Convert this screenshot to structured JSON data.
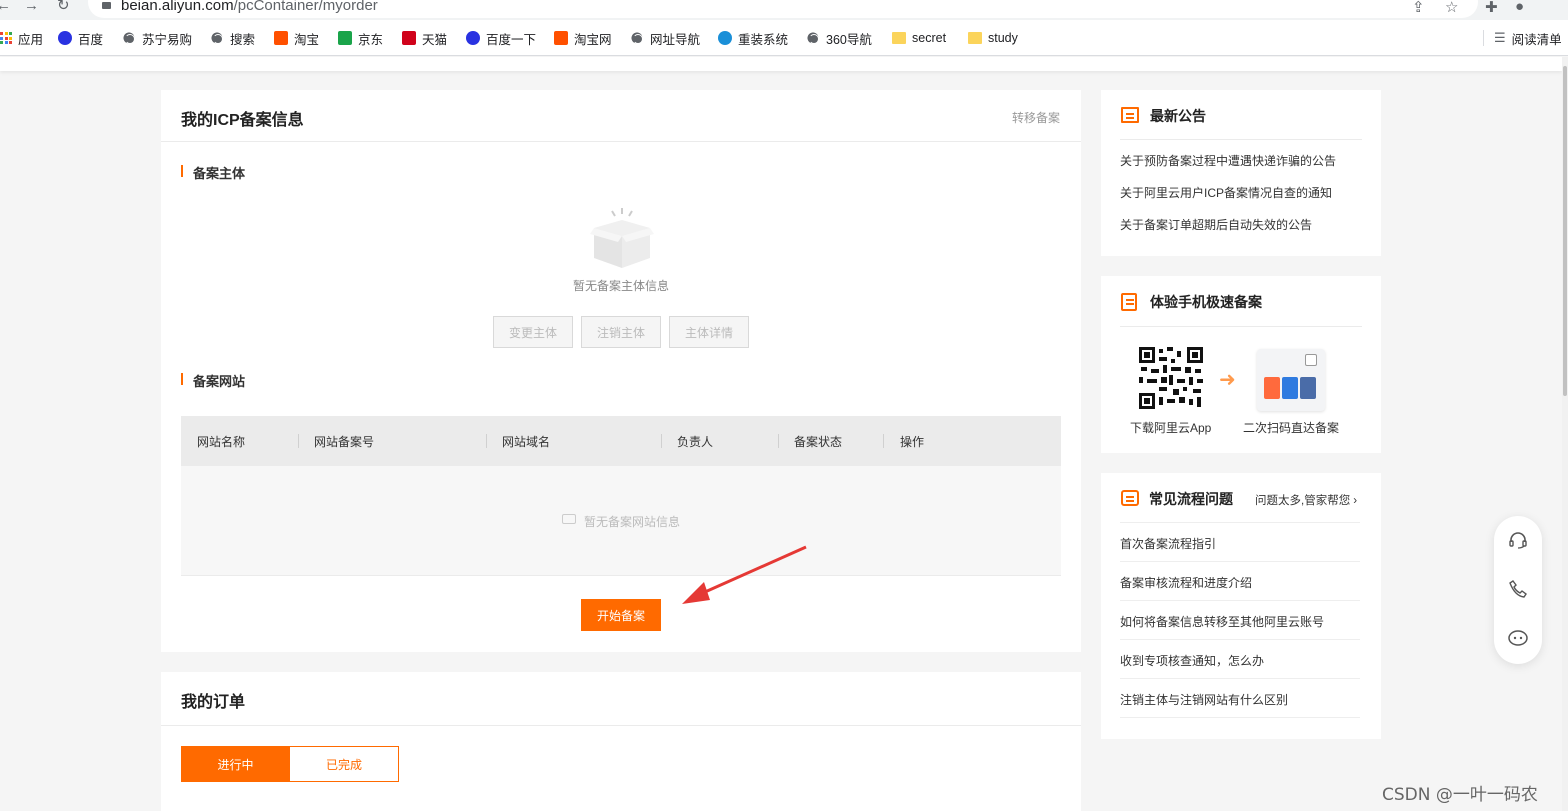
{
  "browser": {
    "url_host": "beian.aliyun.com",
    "url_path": "/pcContainer/myorder",
    "bookmarks": [
      {
        "label": "应用",
        "icon": "apps-grid-icon"
      },
      {
        "label": "百度",
        "icon": "baidu-paw-icon"
      },
      {
        "label": "苏宁易购",
        "icon": "globe-icon"
      },
      {
        "label": "搜索",
        "icon": "globe-icon"
      },
      {
        "label": "淘宝",
        "icon": "taobao-icon"
      },
      {
        "label": "京东",
        "icon": "jd-icon"
      },
      {
        "label": "天猫",
        "icon": "tmall-icon"
      },
      {
        "label": "百度一下",
        "icon": "baidu-paw-icon"
      },
      {
        "label": "淘宝网",
        "icon": "taobao-icon"
      },
      {
        "label": "网址导航",
        "icon": "globe-icon"
      },
      {
        "label": "重装系统",
        "icon": "settings-flower-icon"
      },
      {
        "label": "360导航",
        "icon": "globe-icon"
      },
      {
        "label": "secret",
        "icon": "folder-icon"
      },
      {
        "label": "study",
        "icon": "folder-icon"
      }
    ],
    "reading_list": "阅读清单"
  },
  "icp_card": {
    "title": "我的ICP备案信息",
    "transfer_link": "转移备案",
    "subject_section": "备案主体",
    "empty_subject": "暂无备案主体信息",
    "subject_buttons": [
      "变更主体",
      "注销主体",
      "主体详情"
    ],
    "website_section": "备案网站",
    "table_headers": [
      "网站名称",
      "网站备案号",
      "网站域名",
      "负责人",
      "备案状态",
      "操作"
    ],
    "empty_website": "暂无备案网站信息",
    "start_button": "开始备案"
  },
  "orders_card": {
    "title": "我的订单",
    "tabs": [
      "进行中",
      "已完成"
    ],
    "active_tab": "进行中"
  },
  "announcements": {
    "title": "最新公告",
    "items": [
      "关于预防备案过程中遭遇快递诈骗的公告",
      "关于阿里云用户ICP备案情况自查的通知",
      "关于备案订单超期后自动失效的公告"
    ]
  },
  "mobile": {
    "title": "体验手机极速备案",
    "qr_caption": "下载阿里云App",
    "scan_caption": "二次扫码直达备案"
  },
  "faq": {
    "title": "常见流程问题",
    "help_link": "问题太多,管家帮您",
    "items": [
      "首次备案流程指引",
      "备案审核流程和进度介绍",
      "如何将备案信息转移至其他阿里云账号",
      "收到专项核查通知，怎么办",
      "注销主体与注销网站有什么区别"
    ]
  },
  "float_tools": [
    "headset-icon",
    "phone-icon",
    "chat-bot-icon"
  ],
  "colors": {
    "accent": "#ff6a00",
    "arrow": "#e53935"
  },
  "watermark": "CSDN @一叶一码农"
}
